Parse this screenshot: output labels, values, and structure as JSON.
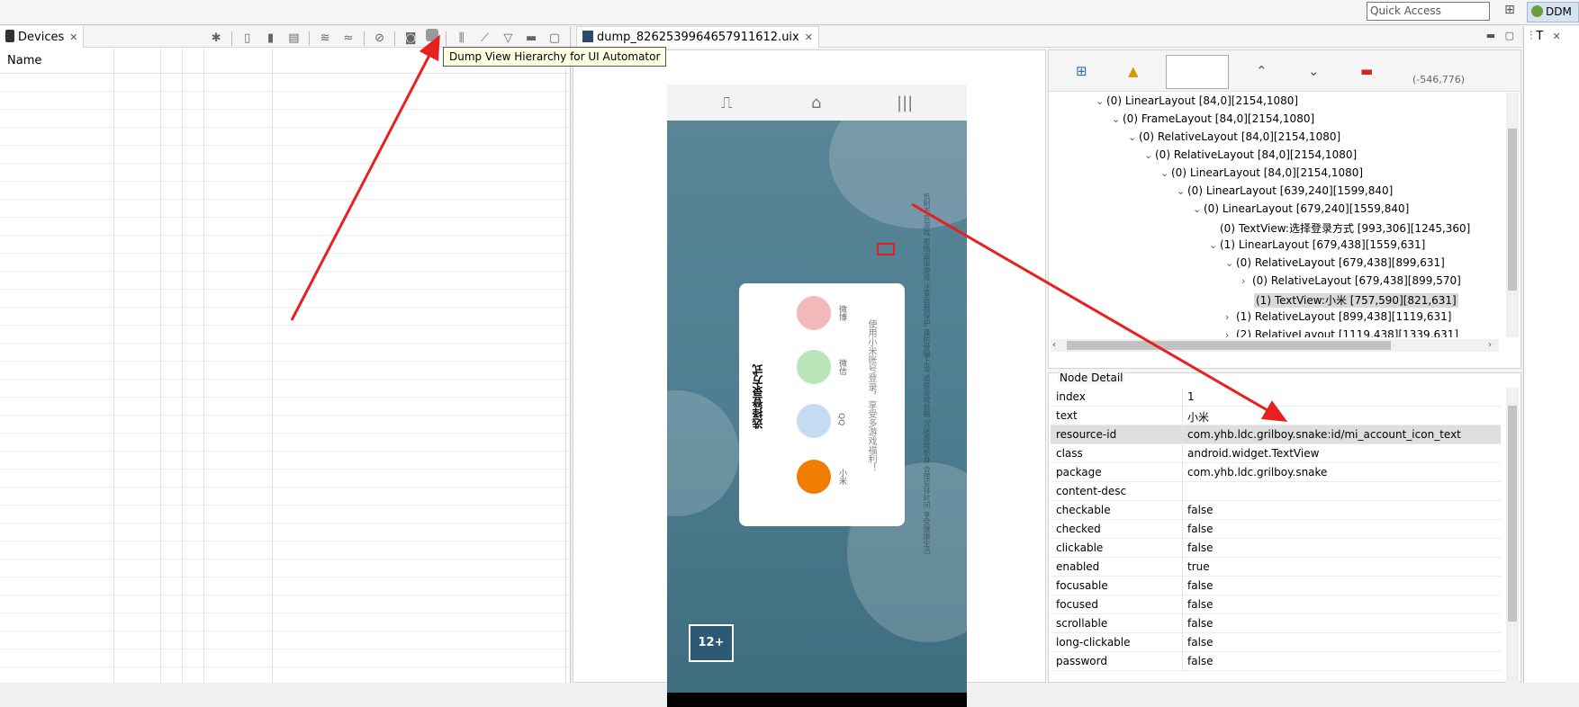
{
  "topbar": {
    "quick_access": "Quick Access",
    "perspective_label": "DDM"
  },
  "devices_view": {
    "tab_label": "Devices",
    "column_name": "Name",
    "tooltip": "Dump View Hierarchy for UI Automator"
  },
  "editor": {
    "tab_label": "dump_8262539964657911612.uix"
  },
  "screenshot": {
    "dialog_title": "选择登录方式",
    "dialog_hint": "使用小米账号登录，享受多游戏福利！",
    "options": [
      {
        "label": "微博",
        "color": "#f3b9b9"
      },
      {
        "label": "微信",
        "color": "#b8e6b8"
      },
      {
        "label": "QQ",
        "color": "#c6dcf4"
      },
      {
        "label": "小米",
        "color": "#f07d00"
      }
    ],
    "age_badge": "12+",
    "side_text": "抵制不良游戏 拒绝盗版游戏 注意自我保护 谨防受骗上当 适度游戏益脑 沉迷游戏伤身 合理安排时间 享受健康生活"
  },
  "hierarchy": {
    "coordinates": "(-546,776)",
    "nodes": [
      {
        "label": "(0) LinearLayout [84,0][2154,1080]",
        "toggle": "v"
      },
      {
        "label": "(0) FrameLayout [84,0][2154,1080]",
        "toggle": "v"
      },
      {
        "label": "(0) RelativeLayout [84,0][2154,1080]",
        "toggle": "v"
      },
      {
        "label": "(0) RelativeLayout [84,0][2154,1080]",
        "toggle": "v"
      },
      {
        "label": "(0) LinearLayout [84,0][2154,1080]",
        "toggle": "v"
      },
      {
        "label": "(0) LinearLayout [639,240][1599,840]",
        "toggle": "v"
      },
      {
        "label": "(0) LinearLayout [679,240][1559,840]",
        "toggle": "v"
      },
      {
        "label": "(0) TextView:选择登录方式 [993,306][1245,360]",
        "toggle": ""
      },
      {
        "label": "(1) LinearLayout [679,438][1559,631]",
        "toggle": "v"
      },
      {
        "label": "(0) RelativeLayout [679,438][899,631]",
        "toggle": "v"
      },
      {
        "label": "(0) RelativeLayout [679,438][899,570]",
        "toggle": ">"
      },
      {
        "label": "(1) TextView:小米 [757,590][821,631]",
        "toggle": ""
      },
      {
        "label": "(1) RelativeLayout [899,438][1119,631]",
        "toggle": ">"
      },
      {
        "label": "(2) RelativeLayout [1119,438][1339,631]",
        "toggle": ">"
      }
    ]
  },
  "node_detail": {
    "title": "Node Detail",
    "rows": [
      {
        "key": "index",
        "value": "1"
      },
      {
        "key": "text",
        "value": "小米"
      },
      {
        "key": "resource-id",
        "value": "com.yhb.ldc.grilboy.snake:id/mi_account_icon_text"
      },
      {
        "key": "class",
        "value": "android.widget.TextView"
      },
      {
        "key": "package",
        "value": "com.yhb.ldc.grilboy.snake"
      },
      {
        "key": "content-desc",
        "value": ""
      },
      {
        "key": "checkable",
        "value": "false"
      },
      {
        "key": "checked",
        "value": "false"
      },
      {
        "key": "clickable",
        "value": "false"
      },
      {
        "key": "enabled",
        "value": "true"
      },
      {
        "key": "focusable",
        "value": "false"
      },
      {
        "key": "focused",
        "value": "false"
      },
      {
        "key": "scrollable",
        "value": "false"
      },
      {
        "key": "long-clickable",
        "value": "false"
      },
      {
        "key": "password",
        "value": "false"
      }
    ]
  },
  "t_view": {
    "tab_label": "T"
  },
  "colors": {
    "accent_red": "#e82020",
    "selection": "#d9d9d9"
  }
}
